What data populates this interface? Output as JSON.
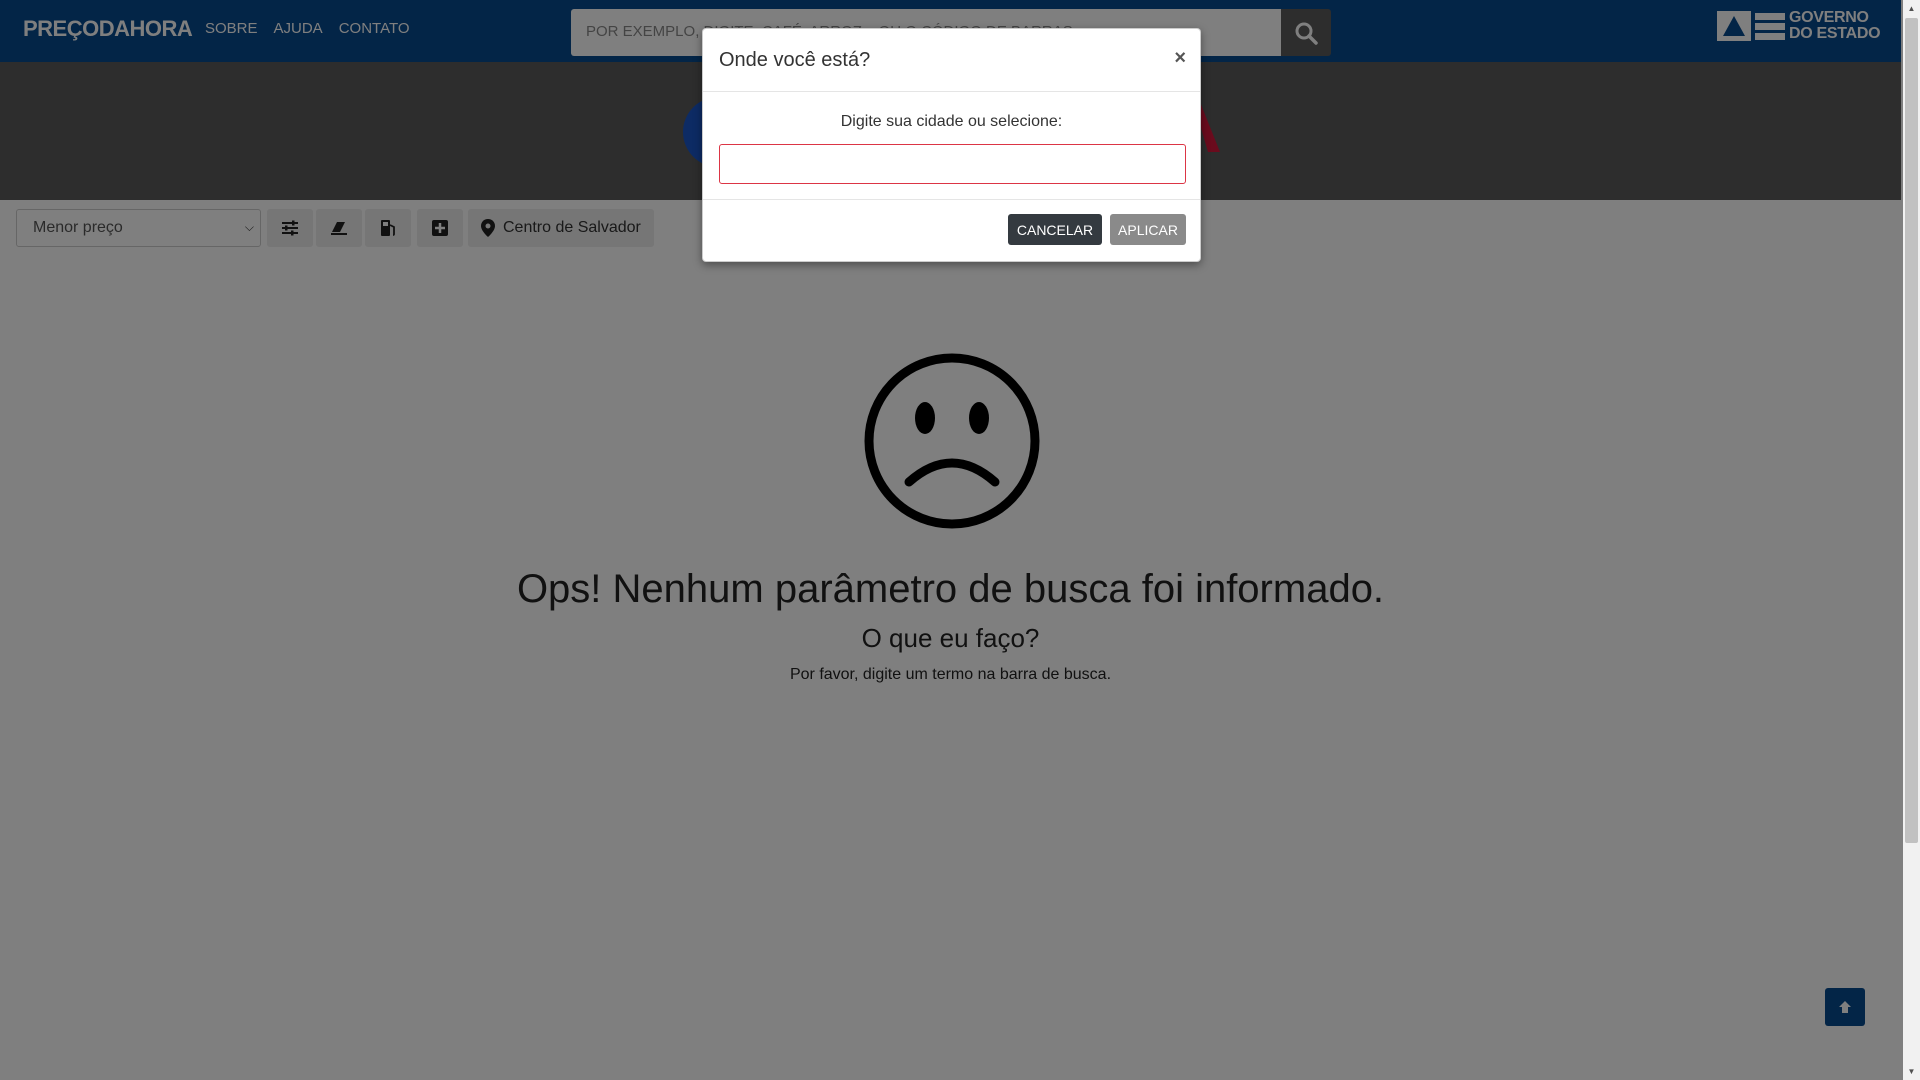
{
  "navbar": {
    "brand": "PREÇODAHORA",
    "links": [
      "SOBRE",
      "AJUDA",
      "CONTATO"
    ],
    "search_placeholder": "POR EXEMPLO, DIGITE: CAFÉ, ARROZ... OU O CÓDIGO DE BARRAS",
    "search_icon": "search-icon",
    "gov_logo_line1": "GOVERNO",
    "gov_logo_line2": "DO ESTADO"
  },
  "toolbar": {
    "sort_value": "Menor preço",
    "tools": [
      "filters-icon",
      "eraser-icon",
      "fuel-icon",
      "plus-square-icon"
    ],
    "location_label": "Centro de Salvador"
  },
  "empty_state": {
    "title": "Ops! Nenhum parâmetro de busca foi informado.",
    "subtitle": "O que eu faço?",
    "message": "Por favor, digite um termo na barra de busca."
  },
  "modal": {
    "title": "Onde você está?",
    "close": "×",
    "label": "Digite sua cidade ou selecione:",
    "input_value": "",
    "cancel": "CANCELAR",
    "apply": "APLICAR"
  },
  "colors": {
    "navbar": "#074a8e",
    "cancel_button": "#343a40",
    "apply_button": "#8a8a8a",
    "input_border_error": "#dc3545"
  }
}
